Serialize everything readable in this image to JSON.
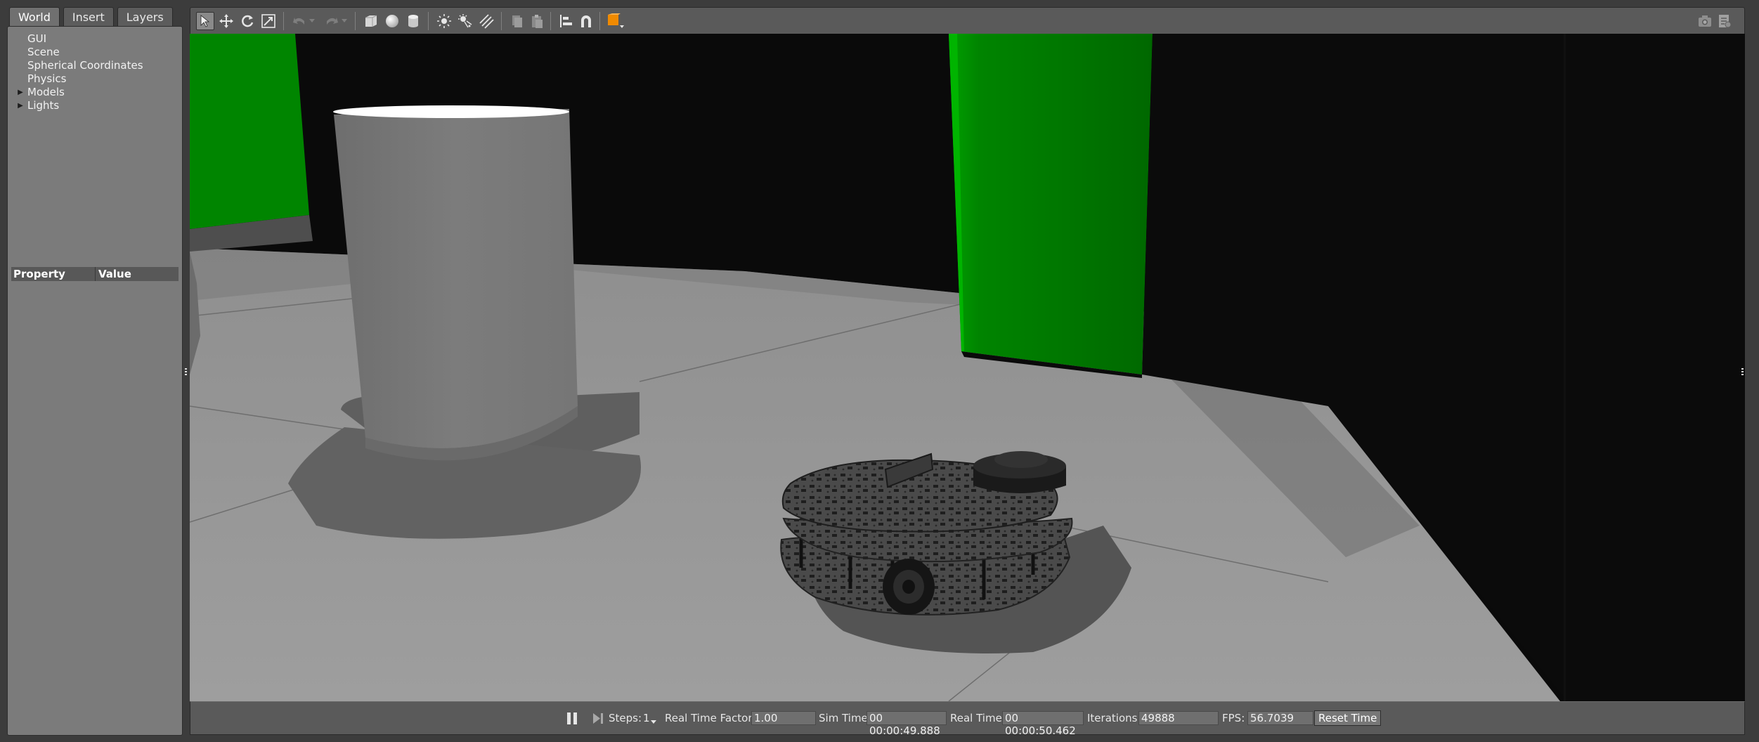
{
  "left_panel": {
    "tabs": [
      "World",
      "Insert",
      "Layers"
    ],
    "active_tab": "World",
    "tree": {
      "gui": "GUI",
      "scene": "Scene",
      "spherical": "Spherical Coordinates",
      "physics": "Physics",
      "models": "Models",
      "lights": "Lights"
    },
    "property_header": {
      "property": "Property",
      "value": "Value"
    }
  },
  "toolbar": {
    "left_tools": [
      "select-arrow-icon",
      "translate-icon",
      "rotate-icon",
      "scale-icon",
      "undo-icon",
      "redo-icon",
      "box-shape-icon",
      "sphere-shape-icon",
      "cylinder-shape-icon",
      "point-light-icon",
      "spot-light-icon",
      "directional-light-icon",
      "copy-icon",
      "paste-icon",
      "align-icon",
      "snap-magnet-icon",
      "view-angle-icon"
    ],
    "right_tools": [
      "screenshot-camera-icon",
      "record-log-icon"
    ],
    "accent_color": "#f08a00"
  },
  "scene": {
    "floor_color": "#9b9b9b",
    "wall_color": "#0a0a0a",
    "green_color": "#008a00",
    "cylinder_color": "#7a7a7a"
  },
  "bottom_bar": {
    "steps_label": "Steps:",
    "steps_value": "1",
    "rtf_label": "Real Time Factor:",
    "rtf_value": "1.00",
    "sim_time_label": "Sim Time:",
    "sim_time_value": "00 00:00:49.888",
    "real_time_label": "Real Time:",
    "real_time_value": "00 00:00:50.462",
    "iterations_label": "Iterations:",
    "iterations_value": "49888",
    "fps_label": "FPS:",
    "fps_value": "56.7039",
    "reset_button": "Reset Time"
  }
}
